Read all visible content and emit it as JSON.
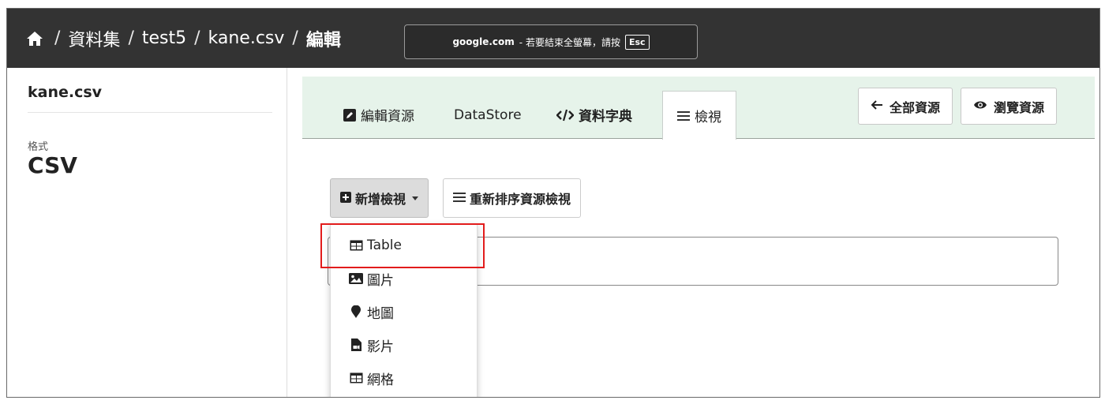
{
  "breadcrumb": {
    "home_icon": "home-icon",
    "items": [
      "資料集",
      "test5",
      "kane.csv"
    ],
    "separator": "/",
    "current": "編輯"
  },
  "fullscreen_notice": {
    "host": "google.com",
    "message": "- 若要結束全螢幕，請按",
    "key": "Esc"
  },
  "sidebar": {
    "title": "kane.csv",
    "format_label": "格式",
    "format_value": "CSV"
  },
  "tabs": [
    {
      "icon": "edit-icon",
      "label": "編輯資源"
    },
    {
      "icon": "",
      "label": "DataStore"
    },
    {
      "icon": "code-icon",
      "label": "資料字典"
    },
    {
      "icon": "list-icon",
      "label": "檢視",
      "active": true
    }
  ],
  "toolbar": {
    "all_resources_label": "全部資源",
    "all_resources_icon": "arrow-left-icon",
    "browse_resource_label": "瀏覽資源",
    "browse_resource_icon": "eye-icon"
  },
  "actions": {
    "new_view_label": "新增檢視",
    "reorder_label": "重新排序資源檢視"
  },
  "dropdown": {
    "items": [
      {
        "icon": "table-icon",
        "label": "Table"
      },
      {
        "icon": "image-icon",
        "label": "圖片"
      },
      {
        "icon": "map-marker-icon",
        "label": "地圖"
      },
      {
        "icon": "video-file-icon",
        "label": "影片"
      },
      {
        "icon": "grid-icon",
        "label": "網格"
      }
    ]
  },
  "colors": {
    "topbar": "#333333",
    "tabbar": "#e6f3ea",
    "highlight": "#e21c1c"
  }
}
